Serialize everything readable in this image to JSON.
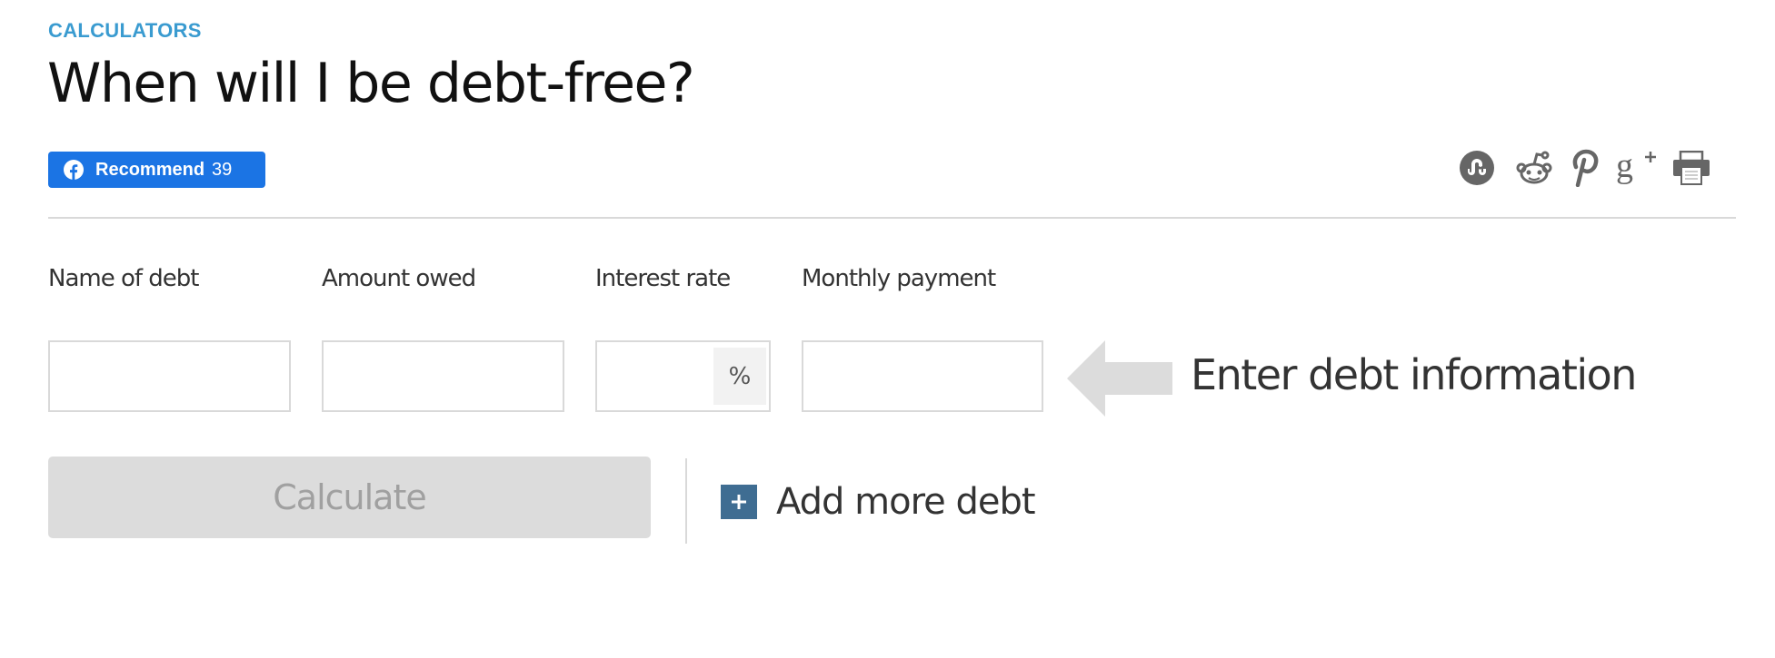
{
  "header": {
    "eyebrow": "CALCULATORS",
    "title": "When will I be debt-free?"
  },
  "social": {
    "facebook": {
      "icon": "facebook-icon",
      "label": "Recommend",
      "count": "39",
      "color": "#1b74e4"
    },
    "share_icons": [
      {
        "name": "stumbleupon-icon"
      },
      {
        "name": "reddit-icon"
      },
      {
        "name": "pinterest-icon"
      },
      {
        "name": "google-plus-icon"
      },
      {
        "name": "print-icon"
      }
    ],
    "icon_color": "#666666"
  },
  "form": {
    "fields": [
      {
        "label": "Name of debt",
        "value": "",
        "placeholder": ""
      },
      {
        "label": "Amount owed",
        "value": "",
        "placeholder": ""
      },
      {
        "label": "Interest rate",
        "value": "",
        "placeholder": "",
        "suffix": "%"
      },
      {
        "label": "Monthly payment",
        "value": "",
        "placeholder": ""
      }
    ],
    "hint": {
      "icon": "arrow-left-icon",
      "text": "Enter debt information"
    },
    "calculate_label": "Calculate",
    "calculate_disabled": true,
    "add_more": {
      "icon": "plus-icon",
      "label": "Add more debt",
      "color": "#3f6d92"
    }
  },
  "colors": {
    "eyebrow": "#3a9bd0",
    "border": "#d9d9d9",
    "button_disabled_bg": "#dcdcdc",
    "button_disabled_text": "#a0a0a0"
  }
}
